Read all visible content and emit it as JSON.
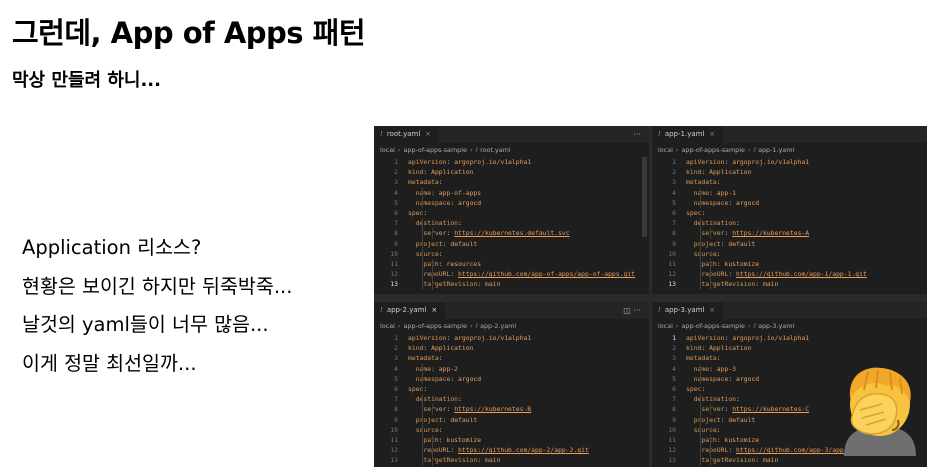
{
  "slide": {
    "title": "그런데, App of Apps 패턴",
    "subtitle": "막상 만들려 하니...",
    "bullets": [
      "Application 리소스?",
      "현황은 보이긴 하지만 뒤죽박죽...",
      "날것의 yaml들이 너무 많음...",
      "이게 정말 최선일까..."
    ]
  },
  "editor": {
    "panes": [
      {
        "tab": "root.yaml",
        "tab_close": "×",
        "actions": "···",
        "breadcrumb": [
          "local",
          "app-of-apps-sample",
          "root.yaml"
        ],
        "active_line": "13",
        "lines": [
          {
            "n": "1",
            "indent": 0,
            "key": "apiVersion",
            "val": "argoproj.io/v1alpha1"
          },
          {
            "n": "2",
            "indent": 0,
            "key": "kind",
            "val": "Application"
          },
          {
            "n": "3",
            "indent": 0,
            "key": "metadata",
            "val": ""
          },
          {
            "n": "4",
            "indent": 1,
            "key": "name",
            "val": "app-of-apps"
          },
          {
            "n": "5",
            "indent": 1,
            "key": "namespace",
            "val": "argocd"
          },
          {
            "n": "6",
            "indent": 0,
            "key": "spec",
            "val": ""
          },
          {
            "n": "7",
            "indent": 1,
            "key": "destination",
            "val": ""
          },
          {
            "n": "8",
            "indent": 2,
            "key": "server",
            "val": "https://kubernetes.default.svc",
            "url": true
          },
          {
            "n": "9",
            "indent": 1,
            "key": "project",
            "val": "default"
          },
          {
            "n": "10",
            "indent": 1,
            "key": "source",
            "val": ""
          },
          {
            "n": "11",
            "indent": 2,
            "key": "path",
            "val": "resources"
          },
          {
            "n": "12",
            "indent": 2,
            "key": "repoURL",
            "val": "https://github.com/app-of-apps/app-of-apps.git",
            "url": true
          },
          {
            "n": "13",
            "indent": 2,
            "key": "targetRevision",
            "val": "main"
          }
        ]
      },
      {
        "tab": "app-1.yaml",
        "tab_close": "×",
        "breadcrumb": [
          "local",
          "app-of-apps-sample",
          "app-1.yaml"
        ],
        "active_line": "13",
        "lines": [
          {
            "n": "1",
            "indent": 0,
            "key": "apiVersion",
            "val": "argoproj.io/v1alpha1"
          },
          {
            "n": "2",
            "indent": 0,
            "key": "kind",
            "val": "Application"
          },
          {
            "n": "3",
            "indent": 0,
            "key": "metadata",
            "val": ""
          },
          {
            "n": "4",
            "indent": 1,
            "key": "name",
            "val": "app-1"
          },
          {
            "n": "5",
            "indent": 1,
            "key": "namespace",
            "val": "argocd"
          },
          {
            "n": "6",
            "indent": 0,
            "key": "spec",
            "val": ""
          },
          {
            "n": "7",
            "indent": 1,
            "key": "destination",
            "val": ""
          },
          {
            "n": "8",
            "indent": 2,
            "key": "server",
            "val": "https://kubernetes-A",
            "url": true
          },
          {
            "n": "9",
            "indent": 1,
            "key": "project",
            "val": "default"
          },
          {
            "n": "10",
            "indent": 1,
            "key": "source",
            "val": ""
          },
          {
            "n": "11",
            "indent": 2,
            "key": "path",
            "val": "kustomize"
          },
          {
            "n": "12",
            "indent": 2,
            "key": "repoURL",
            "val": "https://github.com/app-1/app-1.git",
            "url": true
          },
          {
            "n": "13",
            "indent": 2,
            "key": "targetRevision",
            "val": "main"
          }
        ]
      },
      {
        "tab": "app-2.yaml",
        "tab_close": "×",
        "actions": "◫ ···",
        "breadcrumb": [
          "local",
          "app-of-apps-sample",
          "app-2.yaml"
        ],
        "active_line": "",
        "lines": [
          {
            "n": "1",
            "indent": 0,
            "key": "apiVersion",
            "val": "argoproj.io/v1alpha1"
          },
          {
            "n": "2",
            "indent": 0,
            "key": "kind",
            "val": "Application"
          },
          {
            "n": "3",
            "indent": 0,
            "key": "metadata",
            "val": ""
          },
          {
            "n": "4",
            "indent": 1,
            "key": "name",
            "val": "app-2"
          },
          {
            "n": "5",
            "indent": 1,
            "key": "namespace",
            "val": "argocd"
          },
          {
            "n": "6",
            "indent": 0,
            "key": "spec",
            "val": ""
          },
          {
            "n": "7",
            "indent": 1,
            "key": "destination",
            "val": ""
          },
          {
            "n": "8",
            "indent": 2,
            "key": "server",
            "val": "https://kubernetes-B",
            "url": true
          },
          {
            "n": "9",
            "indent": 1,
            "key": "project",
            "val": "default"
          },
          {
            "n": "10",
            "indent": 1,
            "key": "source",
            "val": ""
          },
          {
            "n": "11",
            "indent": 2,
            "key": "path",
            "val": "kustomize"
          },
          {
            "n": "12",
            "indent": 2,
            "key": "repoURL",
            "val": "https://github.com/app-2/app-2.git",
            "url": true
          },
          {
            "n": "13",
            "indent": 2,
            "key": "targetRevision",
            "val": "main"
          }
        ]
      },
      {
        "tab": "app-3.yaml",
        "tab_close": "×",
        "breadcrumb": [
          "local",
          "app-of-apps-sample",
          "app-3.yaml"
        ],
        "active_line": "1",
        "lines": [
          {
            "n": "1",
            "indent": 0,
            "key": "apiVersion",
            "val": "argoproj.io/v1alpha1"
          },
          {
            "n": "2",
            "indent": 0,
            "key": "kind",
            "val": "Application"
          },
          {
            "n": "3",
            "indent": 0,
            "key": "metadata",
            "val": ""
          },
          {
            "n": "4",
            "indent": 1,
            "key": "name",
            "val": "app-3"
          },
          {
            "n": "5",
            "indent": 1,
            "key": "namespace",
            "val": "argocd"
          },
          {
            "n": "6",
            "indent": 0,
            "key": "spec",
            "val": ""
          },
          {
            "n": "7",
            "indent": 1,
            "key": "destination",
            "val": ""
          },
          {
            "n": "8",
            "indent": 2,
            "key": "server",
            "val": "https://kubernetes-C",
            "url": true
          },
          {
            "n": "9",
            "indent": 1,
            "key": "project",
            "val": "default"
          },
          {
            "n": "10",
            "indent": 1,
            "key": "source",
            "val": ""
          },
          {
            "n": "11",
            "indent": 2,
            "key": "path",
            "val": "kustomize"
          },
          {
            "n": "12",
            "indent": 2,
            "key": "repoURL",
            "val": "https://github.com/app-3/app-3.git",
            "url": true
          },
          {
            "n": "13",
            "indent": 2,
            "key": "targetRevision",
            "val": "main"
          }
        ]
      }
    ]
  },
  "decoration": {
    "emoji": "face-palm-emoji",
    "accent": "#f5b433"
  }
}
